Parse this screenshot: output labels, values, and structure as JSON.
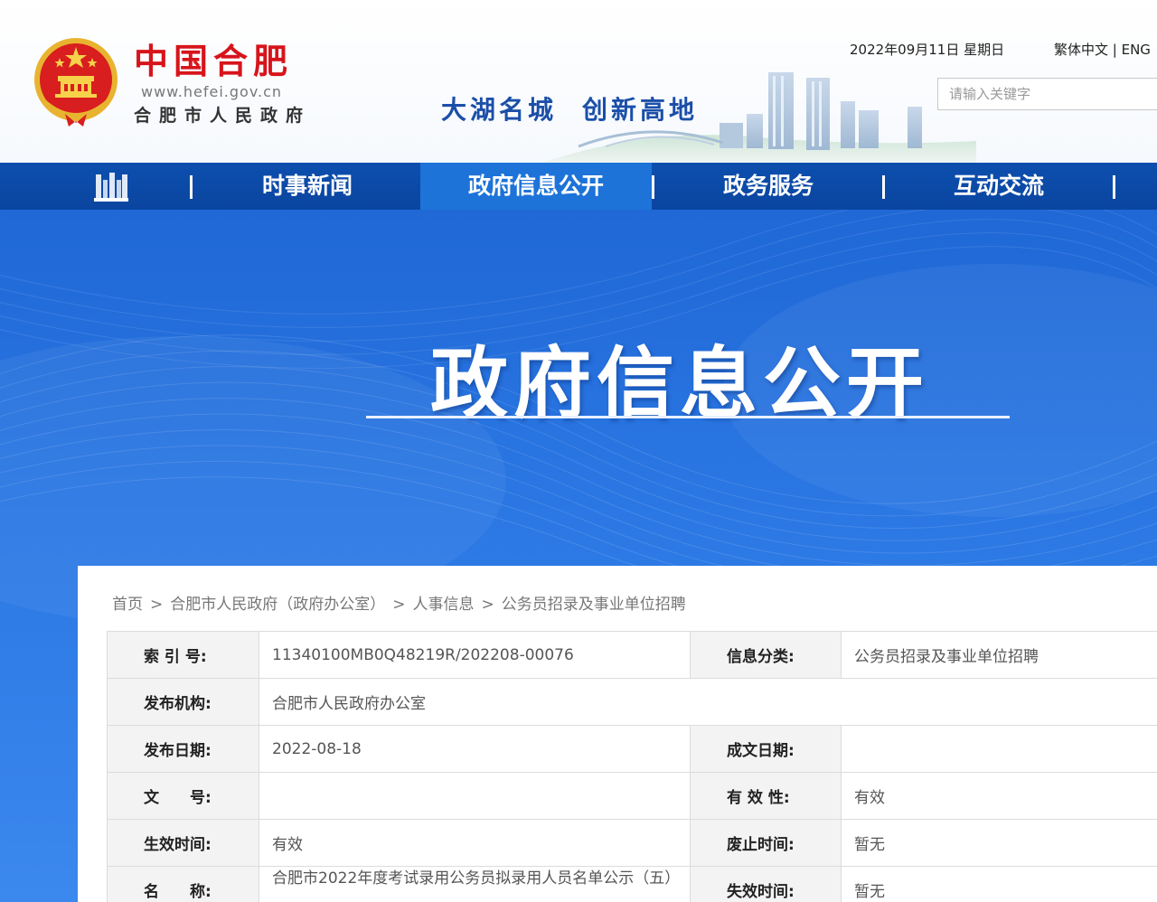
{
  "header": {
    "logo_cn": "中国合肥",
    "logo_url": "www.hefei.gov.cn",
    "logo_sub": "合肥市人民政府",
    "slogan_a": "大湖名城",
    "slogan_b": "创新高地",
    "date": "2022年09月11日 星期日",
    "lang": "繁体中文 | ENG",
    "search_placeholder": "请输入关键字"
  },
  "nav": {
    "items": [
      "时事新闻",
      "政府信息公开",
      "政务服务",
      "互动交流"
    ],
    "active_index": 1
  },
  "banner": {
    "title": "政府信息公开"
  },
  "breadcrumb": [
    "首页",
    "合肥市人民政府（政府办公室）",
    "人事信息",
    "公务员招录及事业单位招聘"
  ],
  "breadcrumb_sep": ">",
  "meta": {
    "index_label": "索 引 号:",
    "index_value": "11340100MB0Q48219R/202208-00076",
    "category_label": "信息分类:",
    "category_value": "公务员招录及事业单位招聘",
    "publisher_label": "发布机构:",
    "publisher_value": "合肥市人民政府办公室",
    "pubdate_label": "发布日期:",
    "pubdate_value": "2022-08-18",
    "writedate_label": "成文日期:",
    "writedate_value": "",
    "docno_label": "文　　号:",
    "docno_value": "",
    "validity_label": "有 效 性:",
    "validity_value": "有效",
    "effective_label": "生效时间:",
    "effective_value": "有效",
    "abolish_label": "废止时间:",
    "abolish_value": "暂无",
    "name_label": "名　　称:",
    "name_value": "合肥市2022年度考试录用公务员拟录用人员名单公示（五）",
    "expire_label": "失效时间:",
    "expire_value": "暂无"
  },
  "colors": {
    "nav_bg": "#0d4fae",
    "nav_active": "#1d73d8",
    "brand_red": "#d7141b",
    "banner_blue": "#2b78e4"
  }
}
